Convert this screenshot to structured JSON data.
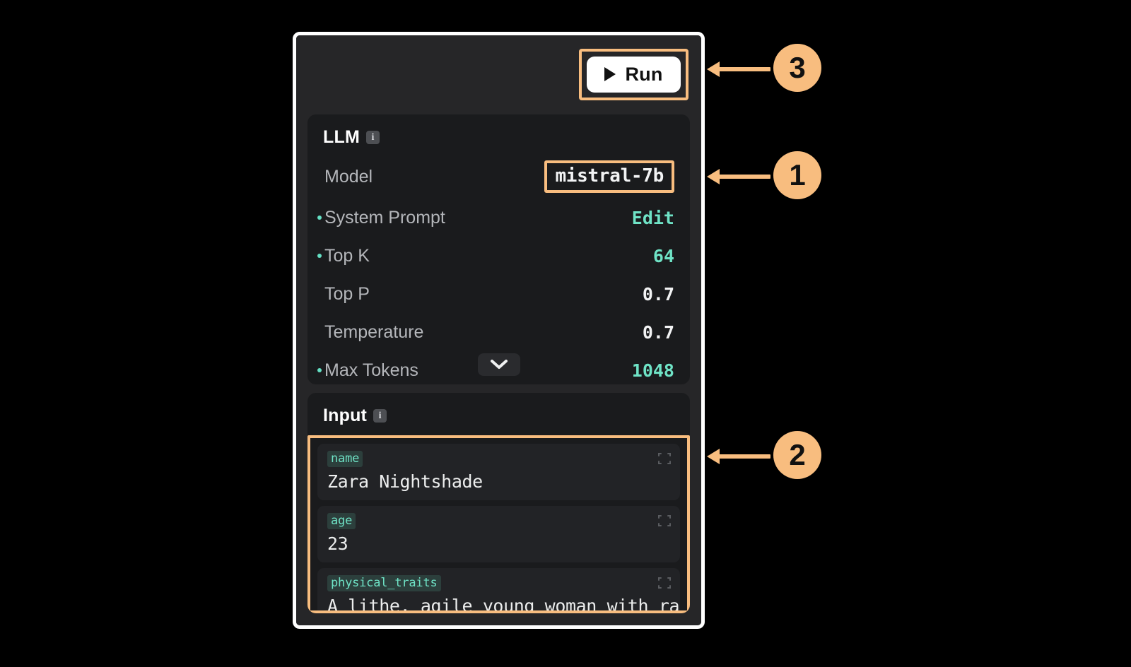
{
  "toolbar": {
    "run_label": "Run",
    "play_icon": "play-icon"
  },
  "llm_section": {
    "title": "LLM",
    "info_icon": "info-icon",
    "info_glyph": "i",
    "collapse_icon": "chevron-down-icon",
    "model_row": {
      "label": "Model",
      "value": "mistral-7b"
    },
    "params": [
      {
        "label": "System Prompt",
        "value": "Edit",
        "bulleted": true,
        "value_color": "teal"
      },
      {
        "label": "Top K",
        "value": "64",
        "bulleted": true,
        "value_color": "teal"
      },
      {
        "label": "Top P",
        "value": "0.7",
        "bulleted": false,
        "value_color": "white"
      },
      {
        "label": "Temperature",
        "value": "0.7",
        "bulleted": false,
        "value_color": "white"
      },
      {
        "label": "Max Tokens",
        "value": "1048",
        "bulleted": true,
        "value_color": "teal"
      }
    ]
  },
  "input_section": {
    "title": "Input",
    "info_icon": "info-icon",
    "info_glyph": "i",
    "fields": [
      {
        "key": "name",
        "value": "Zara Nightshade"
      },
      {
        "key": "age",
        "value": "23"
      },
      {
        "key": "physical_traits",
        "value": "A lithe, agile young woman with ra"
      }
    ]
  },
  "annotations": [
    {
      "number": "3"
    },
    {
      "number": "1"
    },
    {
      "number": "2"
    }
  ],
  "colors": {
    "accent_orange": "#f8bd7f",
    "accent_teal": "#6fe3c6",
    "panel_bg": "#262628",
    "card_bg": "#1a1b1d",
    "field_bg": "#222326"
  }
}
